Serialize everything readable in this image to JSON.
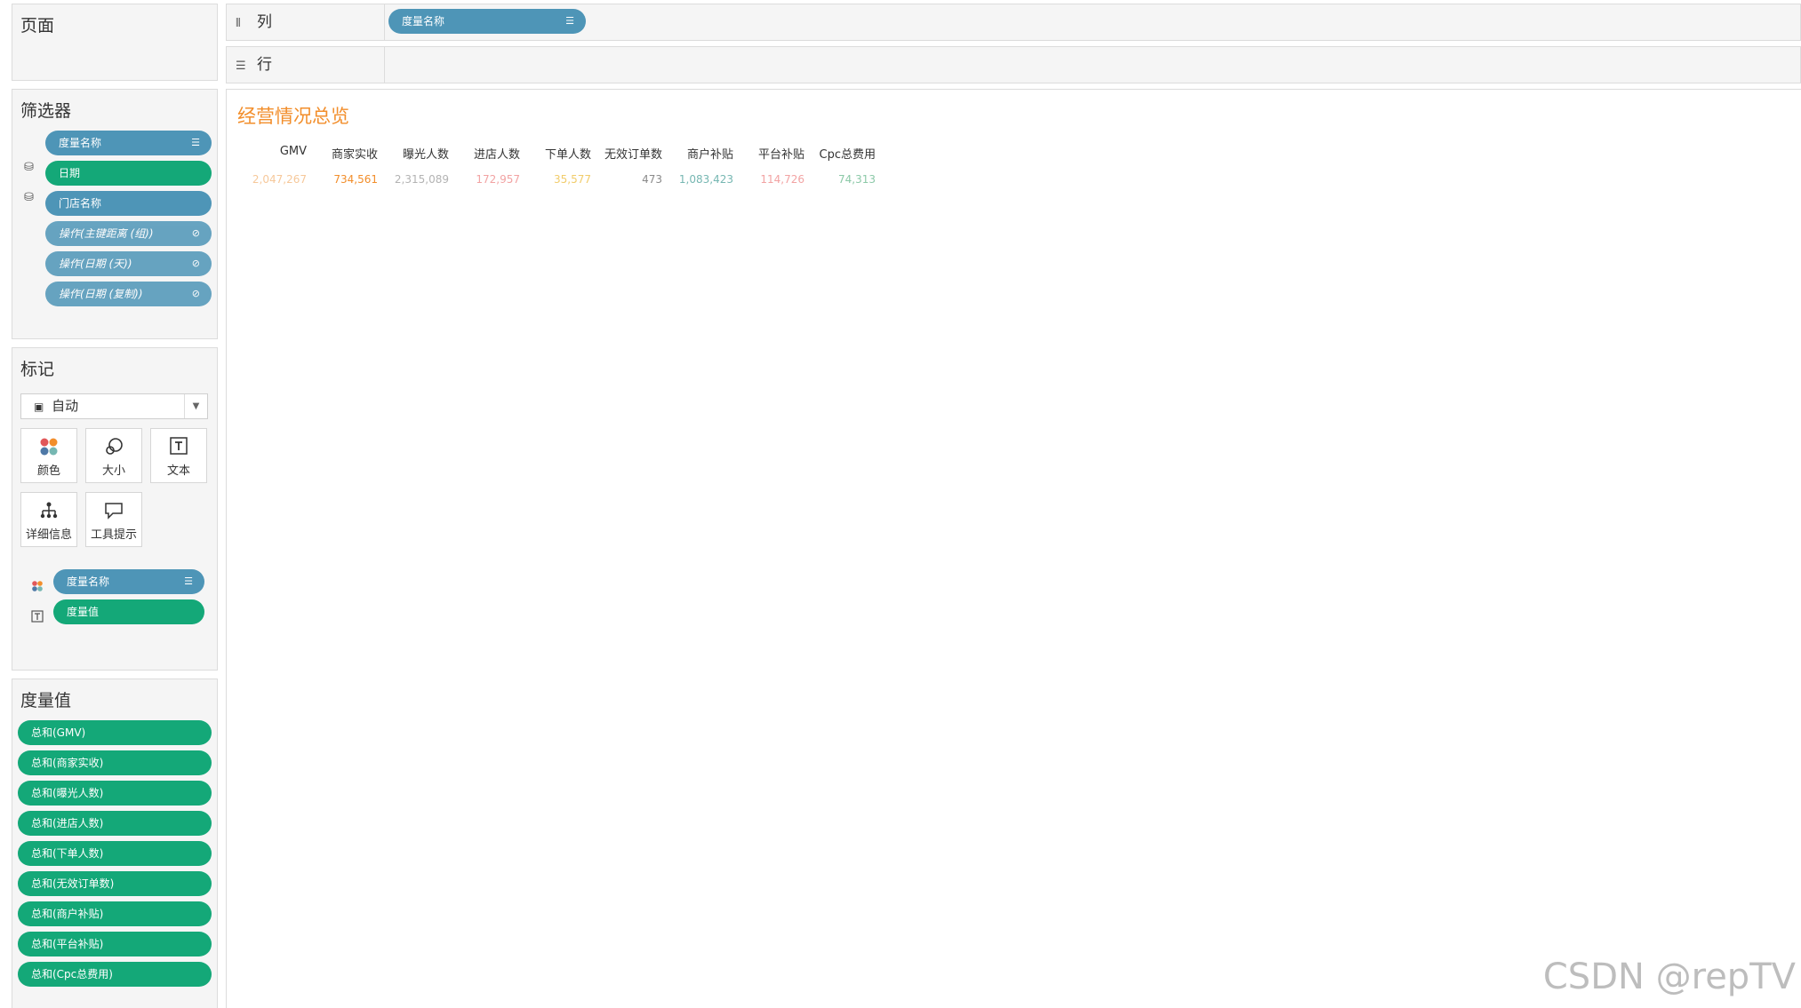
{
  "pages": {
    "title": "页面"
  },
  "filters": {
    "title": "筛选器",
    "items": [
      {
        "label": "度量名称",
        "icon": "sort-icon"
      },
      {
        "label": "日期"
      },
      {
        "label": "门店名称"
      },
      {
        "label": "操作(主键距离 (组))",
        "icon": "link-icon"
      },
      {
        "label": "操作(日期 (天))",
        "icon": "link-icon"
      },
      {
        "label": "操作(日期 (复制))",
        "icon": "link-icon"
      }
    ]
  },
  "marks": {
    "title": "标记",
    "type_select": "自动",
    "buttons": [
      {
        "label": "颜色",
        "icon": "color-icon"
      },
      {
        "label": "大小",
        "icon": "size-icon"
      },
      {
        "label": "文本",
        "icon": "text-icon"
      },
      {
        "label": "详细信息",
        "icon": "detail-icon"
      },
      {
        "label": "工具提示",
        "icon": "tooltip-icon"
      }
    ],
    "fields": [
      {
        "label": "度量名称",
        "icon": "sort-icon"
      },
      {
        "label": "度量值"
      }
    ]
  },
  "measures": {
    "title": "度量值",
    "items": [
      "总和(GMV)",
      "总和(商家实收)",
      "总和(曝光人数)",
      "总和(进店人数)",
      "总和(下单人数)",
      "总和(无效订单数)",
      "总和(商户补贴)",
      "总和(平台补贴)",
      "总和(Cpc总费用)"
    ]
  },
  "shelves": {
    "columns_label": "列",
    "columns_pill": "度量名称",
    "rows_label": "行"
  },
  "view": {
    "title": "经营情况总览",
    "headers": [
      "GMV",
      "商家实收",
      "曝光人数",
      "进店人数",
      "下单人数",
      "无效订单数",
      "商户补贴",
      "平台补贴",
      "Cpc总费用"
    ],
    "values": [
      "2,047,267",
      "734,561",
      "2,315,089",
      "172,957",
      "35,577",
      "473",
      "1,083,423",
      "114,726",
      "74,313"
    ],
    "value_colors": [
      "#f6c89a",
      "#f28e2b",
      "#b3b3b3",
      "#f2a3a3",
      "#f1cc6b",
      "#8a8a8a",
      "#76b7b2",
      "#f2a3a3",
      "#8cc9a8"
    ],
    "title_color": "#f28e2b"
  },
  "colors": {
    "pill_blue": "#4e95b7",
    "pill_green": "#14a878"
  },
  "watermark": "CSDN @repTV"
}
